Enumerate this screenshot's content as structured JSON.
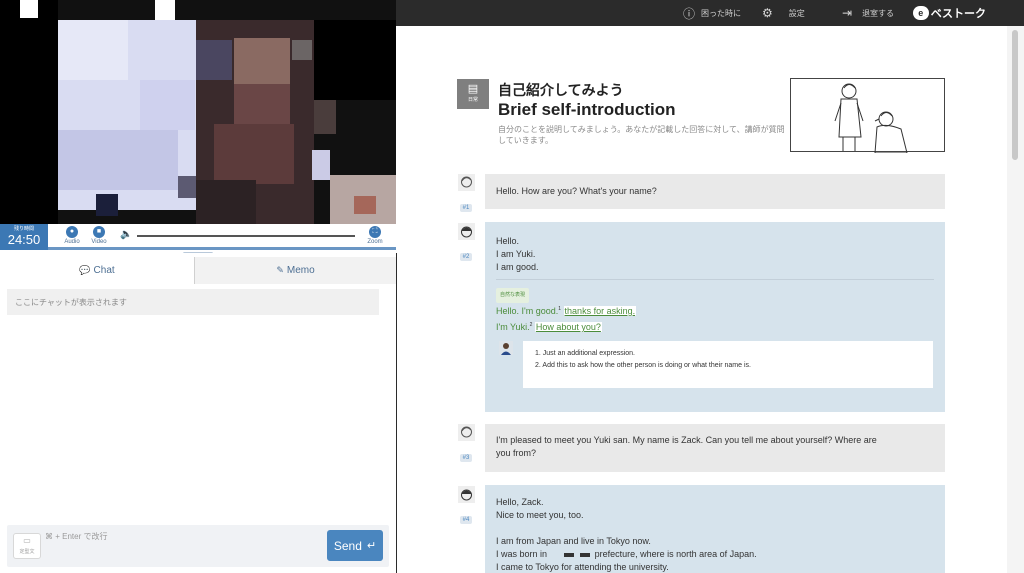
{
  "topbar": {
    "help_label": "困った時に",
    "settings_label": "設定",
    "exit_label": "退室する",
    "brand_name": "ベストーク",
    "colors": {
      "background": "#2b2b2b",
      "text": "#cfcfcf"
    }
  },
  "call": {
    "timer_label": "残り時間",
    "timer_value": "24:50",
    "audio_label": "Audio",
    "video_label": "Video",
    "zoom_label": "Zoom",
    "accent": "#3c78b4"
  },
  "tabs": {
    "chat_label": "Chat",
    "memo_label": "Memo"
  },
  "chat": {
    "empty_message": "ここにチャットが表示されます",
    "fixed_phrase_label": "定型文",
    "input_hint": "⌘ + Enter で改行",
    "send_label": "Send"
  },
  "lesson": {
    "category_label": "日常",
    "title_jp": "自己紹介してみよう",
    "title_en": "Brief self-introduction",
    "description": "自分のことを説明してみましょう。あなたが記載した回答に対して、講師が質問していきます。"
  },
  "messages": [
    {
      "num": "#1",
      "lines": [
        "Hello. How are you? What's your name?"
      ]
    },
    {
      "num": "#2",
      "lines": [
        "Hello.",
        "I am Yuki.",
        "I am good."
      ],
      "natural_tag": "自然な表現",
      "corrections": [
        {
          "prefix": "Hello. I'm good.",
          "sup": "1",
          "highlight": "thanks for asking."
        },
        {
          "prefix": "I'm Yuki.",
          "sup": "2",
          "highlight": "How about you?"
        }
      ],
      "notes": [
        "1. Just an additional expression.",
        "2. Add this to ask how the other person is doing or what their name is."
      ]
    },
    {
      "num": "#3",
      "lines": [
        "I'm pleased to meet you Yuki san. My name is Zack. Can you tell me about yourself? Where are",
        "you from?"
      ]
    },
    {
      "num": "#4",
      "lines": [
        "Hello, Zack.",
        "Nice to meet you, too.",
        "",
        "I am from Japan and live in Tokyo now."
      ],
      "born_prefix": "I was born in",
      "born_suffix": "prefecture, where is north area of Japan.",
      "last_line": "I came to Tokyo for attending the university."
    }
  ]
}
